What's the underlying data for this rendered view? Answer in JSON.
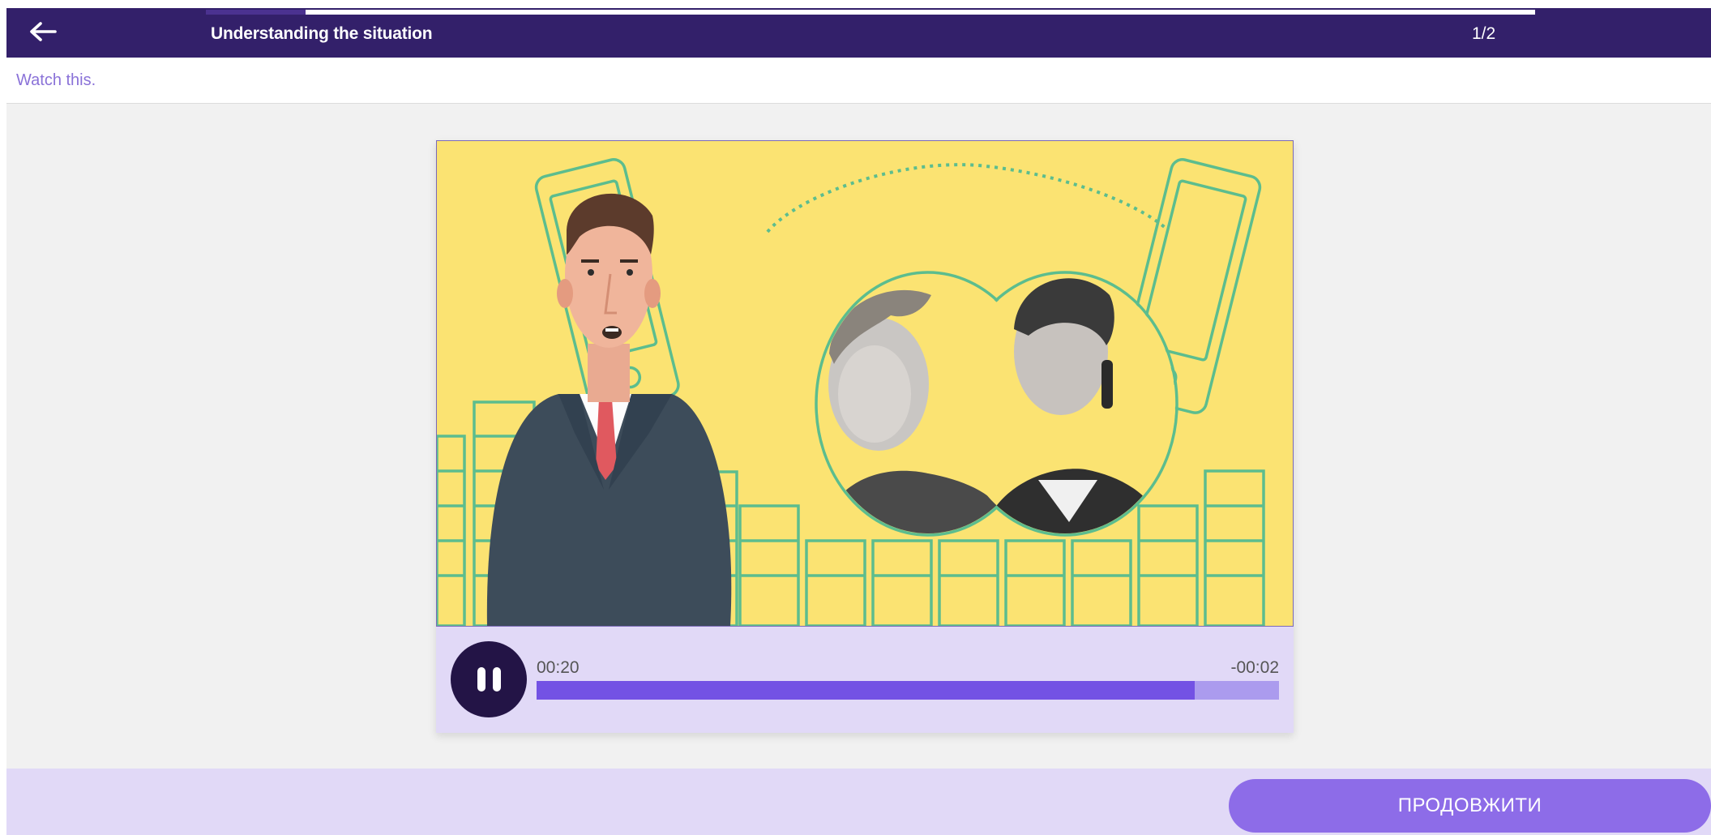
{
  "header": {
    "title": "Understanding the situation",
    "counter": "1/2",
    "lesson_progress": 0.075,
    "colors": {
      "background": "#33206a",
      "accent": "#4b3290"
    },
    "back_icon": "arrow-left-icon"
  },
  "instruction": "Watch this.",
  "player": {
    "current_time": "00:20",
    "remaining_time": "-00:02",
    "progress": 0.887,
    "state": "playing",
    "play_icon": "pause-icon",
    "colors": {
      "fill": "#7352e4",
      "track": "#ab9bee",
      "button": "#231446"
    }
  },
  "footer": {
    "continue_label": "ПРОДОВЖИТИ",
    "button_color": "#8d6ce8"
  }
}
